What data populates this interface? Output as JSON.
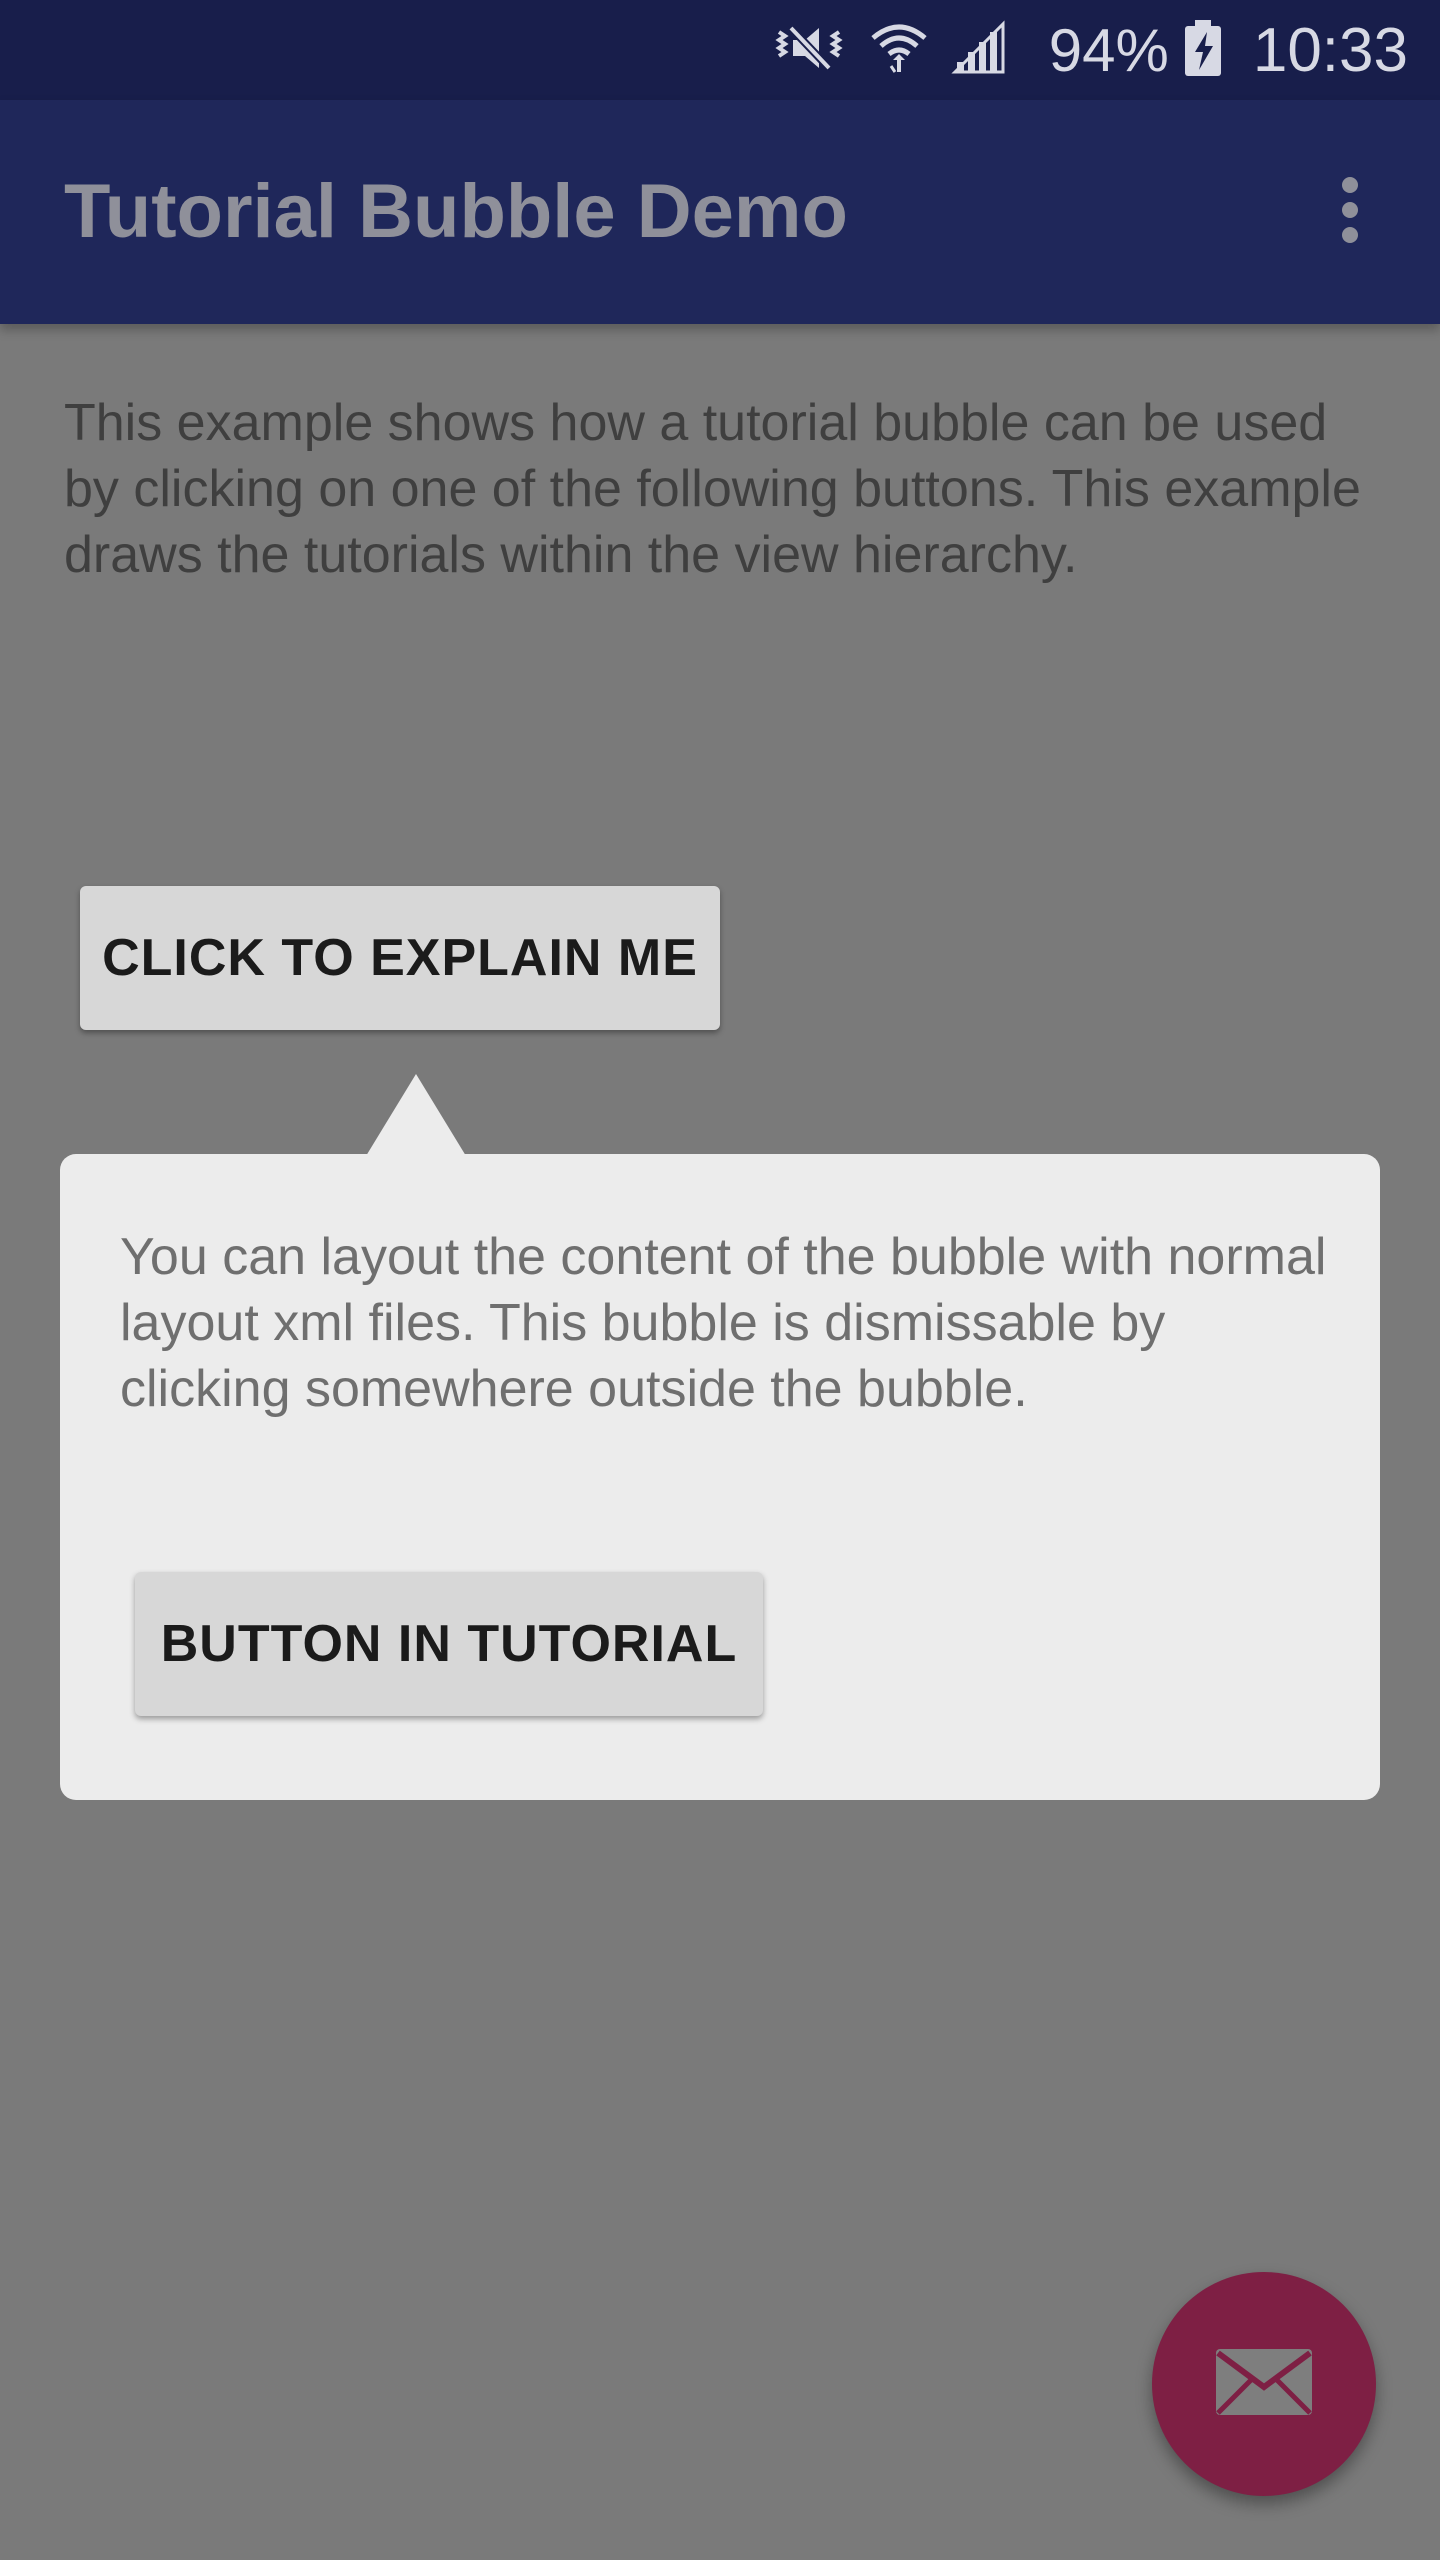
{
  "status_bar": {
    "battery_percent": "94%",
    "time": "10:33",
    "icons": [
      "vibrate-icon",
      "wifi-icon",
      "signal-icon",
      "battery-charging-icon"
    ],
    "colors": {
      "background": "#181e4b",
      "foreground": "#d7d9e4"
    }
  },
  "app_bar": {
    "title": "Tutorial Bubble Demo",
    "menu_icon": "overflow-menu-icon",
    "colors": {
      "background": "#1f275a",
      "title": "#8f909a"
    }
  },
  "main": {
    "description": "This example shows how a tutorial bubble can be used by clicking on one of the following buttons. This example draws the tutorials within the view hierarchy.",
    "explain_button_label": "CLICK TO EXPLAIN ME"
  },
  "tutorial_bubble": {
    "text": "You can layout the content of the bubble with normal layout xml files. This bubble is dismissable by clicking somewhere outside the bubble.",
    "button_label": "BUTTON IN TUTORIAL",
    "colors": {
      "background": "#ececec",
      "text": "#6f6f6f"
    }
  },
  "fab": {
    "icon": "mail-icon",
    "color": "#7e1f44"
  },
  "overlay_color": "#7a7a7a"
}
